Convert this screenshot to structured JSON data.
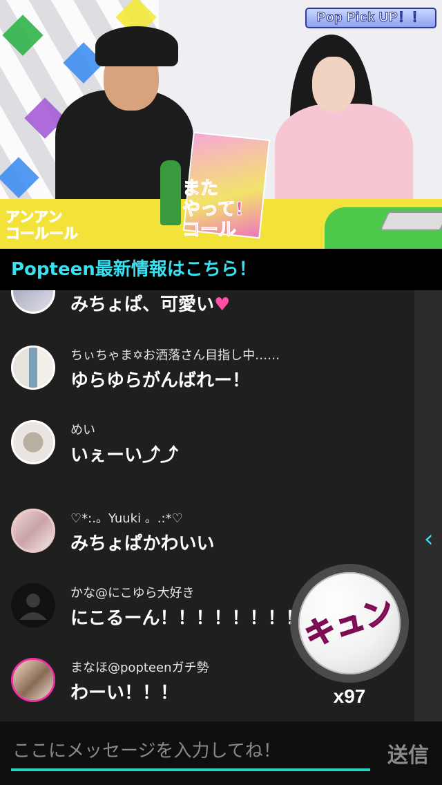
{
  "video": {
    "corner_badge": "Pop Pick UP！！",
    "captions": {
      "left": "アンアン\nコールール",
      "center": "また\nやって!\nコール"
    }
  },
  "banner": {
    "text": "Popteen最新情報はこちら！"
  },
  "messages": [
    {
      "user": "",
      "text": "みちょぱ、可愛い",
      "avatar_icon": "avatar-photo"
    },
    {
      "user": "ちぃちゃま✡お洒落さん目指し中……",
      "text": "ゆらゆらがんばれー！",
      "avatar_icon": "avatar-photo"
    },
    {
      "user": "めい",
      "text": "いぇーい⤴︎⤴︎",
      "avatar_icon": "avatar-photo"
    },
    {
      "user": "♡*:.。Yuuki 。.:*♡",
      "text": "みちょぱかわいい",
      "avatar_icon": "avatar-photo"
    },
    {
      "user": "かな@にこゆら大好き",
      "text": "にこるーん！！！！！！！！",
      "avatar_icon": "default-avatar-icon"
    },
    {
      "user": "まなほ@popteenガチ勢",
      "text": "わーい！！！",
      "avatar_icon": "avatar-photo"
    }
  ],
  "kyun": {
    "label": "キュン",
    "count": "x97"
  },
  "input": {
    "placeholder": "ここにメッセージを入力してね！",
    "send_label": "送信"
  },
  "colors": {
    "accent": "#38e0f0",
    "input_underline": "#2ed3c4",
    "kyun_pink": "#ee2fa0"
  }
}
